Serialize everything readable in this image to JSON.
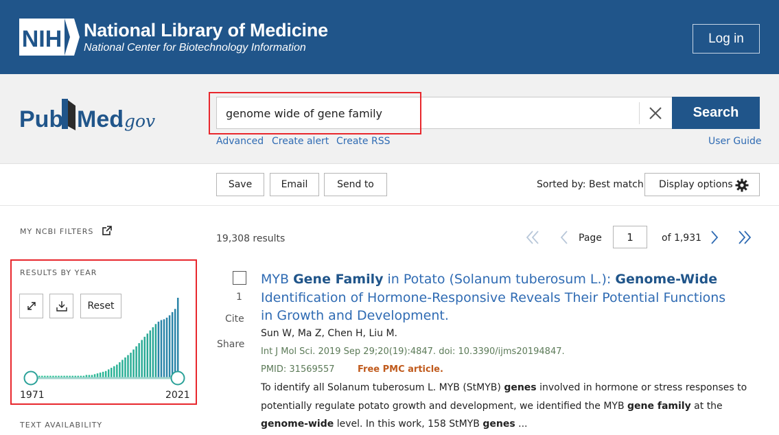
{
  "header": {
    "logo_text": "NIH",
    "title": "National Library of Medicine",
    "subtitle": "National Center for Biotechnology Information",
    "login_label": "Log in"
  },
  "search": {
    "logo_pub": "Pub",
    "logo_med": "Med",
    "logo_gov": ".gov",
    "query": "genome wide of gene family",
    "button_label": "Search",
    "links": [
      "Advanced",
      "Create alert",
      "Create RSS"
    ],
    "user_guide": "User Guide"
  },
  "toolbar": {
    "save_label": "Save",
    "email_label": "Email",
    "send_label": "Send to",
    "sorted_by": "Sorted by: Best match",
    "display_options": "Display options"
  },
  "sidebar": {
    "my_ncbi_filters": "MY NCBI FILTERS",
    "results_by_year": "RESULTS BY YEAR",
    "reset_label": "Reset",
    "year_start": "1971",
    "year_end": "2021",
    "text_availability": "TEXT AVAILABILITY",
    "histogram_relative": [
      0.02,
      0.02,
      0.02,
      0.02,
      0.02,
      0.02,
      0.02,
      0.02,
      0.02,
      0.02,
      0.02,
      0.02,
      0.02,
      0.02,
      0.02,
      0.02,
      0.02,
      0.03,
      0.03,
      0.03,
      0.04,
      0.05,
      0.06,
      0.07,
      0.08,
      0.1,
      0.12,
      0.14,
      0.16,
      0.19,
      0.22,
      0.25,
      0.28,
      0.31,
      0.35,
      0.39,
      0.43,
      0.47,
      0.51,
      0.55,
      0.59,
      0.63,
      0.67,
      0.7,
      0.72,
      0.73,
      0.75,
      0.78,
      0.82,
      0.86,
      1.0
    ]
  },
  "results": {
    "count": "19,308 results",
    "page_label": "Page",
    "page_value": "1",
    "page_of": "of 1,931",
    "item": {
      "number": "1",
      "cite": "Cite",
      "share": "Share",
      "title_parts": [
        {
          "text": "MYB ",
          "bold": false
        },
        {
          "text": "Gene Family",
          "bold": true
        },
        {
          "text": " in Potato (Solanum tuberosum L.): ",
          "bold": false
        },
        {
          "text": "Genome-Wide",
          "bold": true
        },
        {
          "text": " Identification of Hormone-Responsive Reveals Their Potential Functions in Growth and Development.",
          "bold": false
        }
      ],
      "authors": "Sun W, Ma Z, Chen H, Liu M.",
      "citation": "Int J Mol Sci. 2019 Sep 29;20(19):4847. doi: 10.3390/ijms20194847.",
      "pmid": "PMID: 31569557",
      "free_pmc": "Free PMC article.",
      "snippet_lines": [
        [
          {
            "text": "To identify all Solanum tuberosum L. MYB (StMYB) ",
            "bold": false
          },
          {
            "text": "genes",
            "bold": true
          },
          {
            "text": " involved in hormone or stress responses to",
            "bold": false
          }
        ],
        [
          {
            "text": "potentially regulate potato growth and development, we identified the MYB ",
            "bold": false
          },
          {
            "text": "gene family",
            "bold": true
          },
          {
            "text": " at the",
            "bold": false
          }
        ],
        [
          {
            "text": "genome-wide",
            "bold": true
          },
          {
            "text": " level. In this work, 158 StMYB ",
            "bold": false
          },
          {
            "text": "genes",
            "bold": true
          },
          {
            "text": " ...",
            "bold": false
          }
        ]
      ]
    }
  },
  "colors": {
    "nih_blue": "#20558a",
    "link_blue": "#2f6bb3",
    "highlight_red": "#e8262c",
    "histogram_teal": "#2aa198"
  }
}
